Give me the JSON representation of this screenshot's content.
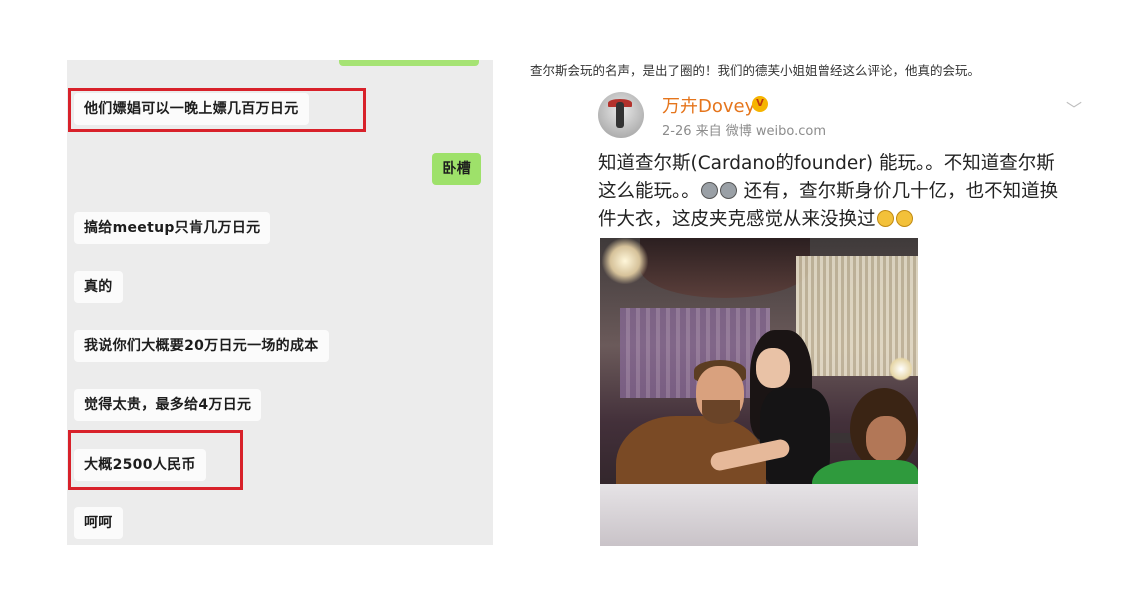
{
  "chat": {
    "messages": [
      {
        "side": "left",
        "text": "他们嫖娼可以一晚上嫖几百万日元",
        "highlighted": true
      },
      {
        "side": "right",
        "text": "卧槽"
      },
      {
        "side": "left",
        "text": "搞给meetup只肯几万日元"
      },
      {
        "side": "left",
        "text": "真的"
      },
      {
        "side": "left",
        "text": "我说你们大概要20万日元一场的成本"
      },
      {
        "side": "left",
        "text": "觉得太贵，最多给4万日元"
      },
      {
        "side": "left",
        "text": "大概2500人民币",
        "highlighted": true
      },
      {
        "side": "left",
        "text": "呵呵"
      }
    ],
    "highlight_color": "#d8212a",
    "bubble_right_color": "#9ee16a"
  },
  "caption": "查尔斯会玩的名声，是出了圈的！我们的德芙小姐姐曾经这么评论，他真的会玩。",
  "weibo": {
    "username": "万卉Dovey",
    "badge": "V",
    "meta": "2-26  来自 微博 weibo.com",
    "chevron": "﹀",
    "text_line1": "知道查尔斯(Cardano的founder) 能玩。。不知道查尔斯",
    "text_line2a": "这么能玩。。",
    "text_line2b": "还有，查尔斯身价几十亿，也不知道换",
    "text_line3": "件大衣，这皮夹克感觉从来没换过",
    "username_color": "#e5751c",
    "icons": [
      "avatar",
      "verified-badge-icon",
      "chevron-down-icon",
      "crying-emoji-icon",
      "smile-emoji-icon"
    ]
  }
}
